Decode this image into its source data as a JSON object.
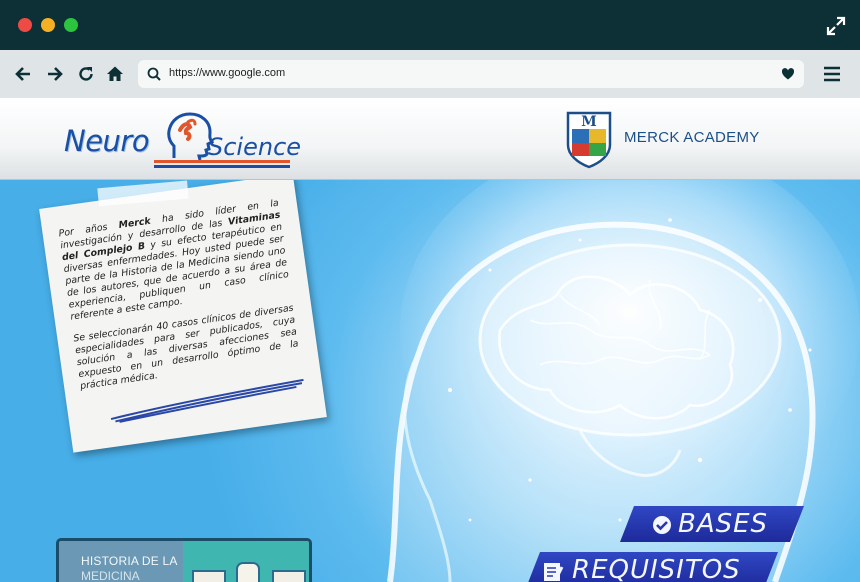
{
  "browser": {
    "url": "https://www.google.com",
    "window_controls": [
      "close",
      "minimize",
      "maximize"
    ],
    "icons": {
      "back": "arrow-left-icon",
      "forward": "arrow-right-icon",
      "reload": "reload-icon",
      "home": "home-icon",
      "search": "search-icon",
      "bookmark": "heart-icon",
      "menu": "hamburger-menu-icon",
      "fullscreen": "expand-icon"
    }
  },
  "header": {
    "logo_left": {
      "word1": "Neuro",
      "word2": "Science"
    },
    "logo_right": {
      "shield_letter": "M",
      "text": "MERCK ACADEMY"
    }
  },
  "note": {
    "p1_a": "Por años ",
    "p1_brand": "Merck",
    "p1_b": " ha sido líder en la investigación y desarrollo de las ",
    "p1_bold": "Vitaminas del Complejo B",
    "p1_c": " y su efecto terapéutico en diversas enfermedades. Hoy usted puede ser parte de la Historia de la Medicina siendo uno de los autores, que de acuerdo a su área de experiencia, publiquen un caso clínico referente a este campo.",
    "p2": "Se seleccionarán 40 casos clínicos de diversas especialidades para ser publicados, cuya solución a las diversas afecciones sea expuesto en un desarrollo óptimo de la práctica médica."
  },
  "thumbnail": {
    "line1": "HISTORIA DE LA",
    "line2": "MEDICINA"
  },
  "buttons": {
    "bases": "BASES",
    "requisitos": "REQUISITOS"
  },
  "colors": {
    "chrome_dark": "#0c3035",
    "toolbar": "#dfe4e6",
    "hero_blue": "#47aee8",
    "button_blue": "#2538b0",
    "brand_orange": "#e2562b",
    "brand_blue": "#1a4fa5"
  }
}
